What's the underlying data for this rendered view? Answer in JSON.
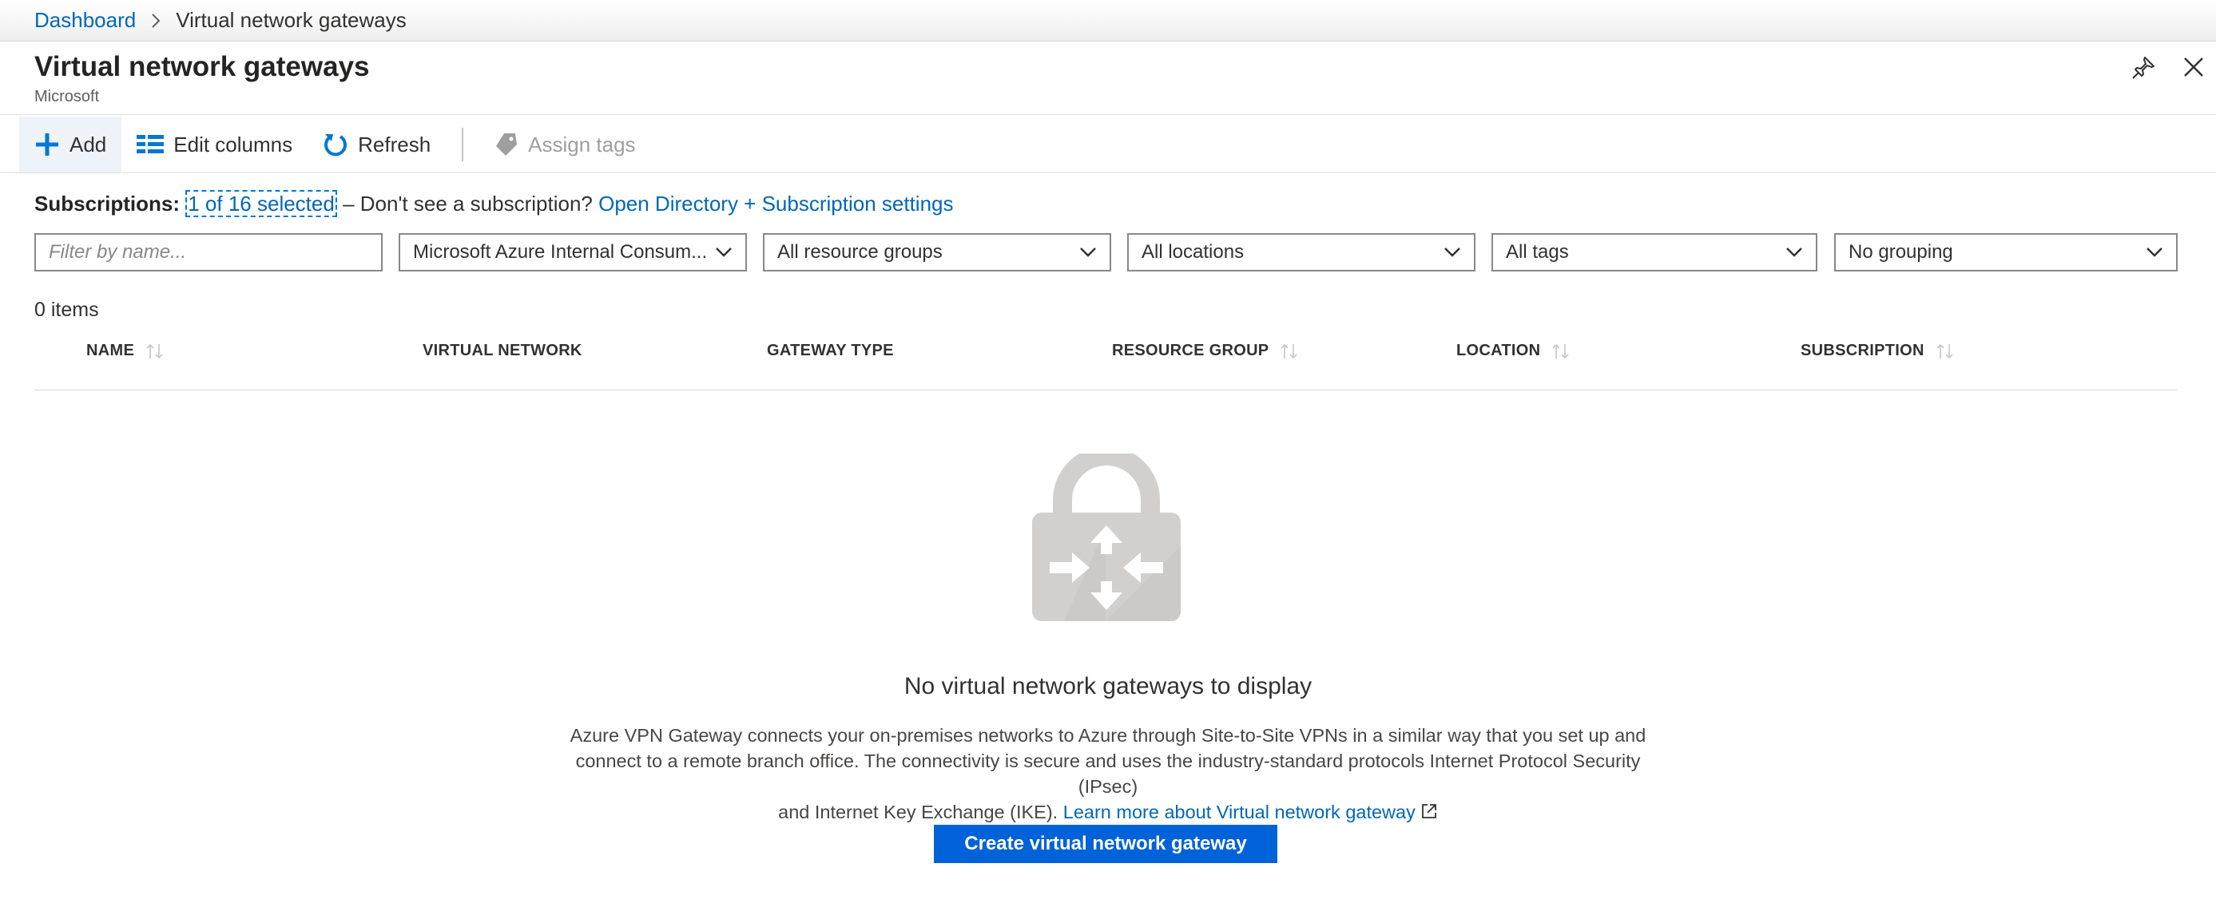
{
  "breadcrumb": {
    "root": "Dashboard",
    "current": "Virtual network gateways"
  },
  "header": {
    "title": "Virtual network gateways",
    "subtitle": "Microsoft"
  },
  "toolbar": {
    "add": "Add",
    "edit_columns": "Edit columns",
    "refresh": "Refresh",
    "assign_tags": "Assign tags"
  },
  "subscriptions": {
    "label": "Subscriptions:",
    "selected": "1 of 16 selected",
    "prompt": "– Don't see a subscription?",
    "link": "Open Directory + Subscription settings"
  },
  "filters": {
    "name_placeholder": "Filter by name...",
    "subscription": "Microsoft Azure Internal Consum...",
    "resource_groups": "All resource groups",
    "locations": "All locations",
    "tags": "All tags",
    "grouping": "No grouping"
  },
  "item_count": "0 items",
  "columns": [
    "NAME",
    "VIRTUAL NETWORK",
    "GATEWAY TYPE",
    "RESOURCE GROUP",
    "LOCATION",
    "SUBSCRIPTION"
  ],
  "empty_state": {
    "title": "No virtual network gateways to display",
    "line1": "Azure VPN Gateway connects your on-premises networks to Azure through Site-to-Site VPNs in a similar way that you set up and",
    "line2": "connect to a remote branch office. The connectivity is secure and uses the industry-standard protocols Internet Protocol Security (IPsec)",
    "line3": "and Internet Key Exchange (IKE).",
    "learn_more": "Learn more about Virtual network gateway",
    "button": "Create virtual network gateway"
  },
  "colors": {
    "accent": "#0078d4",
    "link": "#0067b8",
    "button": "#0062d9",
    "icon_gray": "#d2d0ce"
  },
  "icons": [
    "chevron-right-icon",
    "pin-icon",
    "close-icon",
    "plus-icon",
    "columns-icon",
    "refresh-icon",
    "tag-icon",
    "chevron-down-icon",
    "sort-icon",
    "vpn-gateway-icon",
    "external-link-icon"
  ]
}
